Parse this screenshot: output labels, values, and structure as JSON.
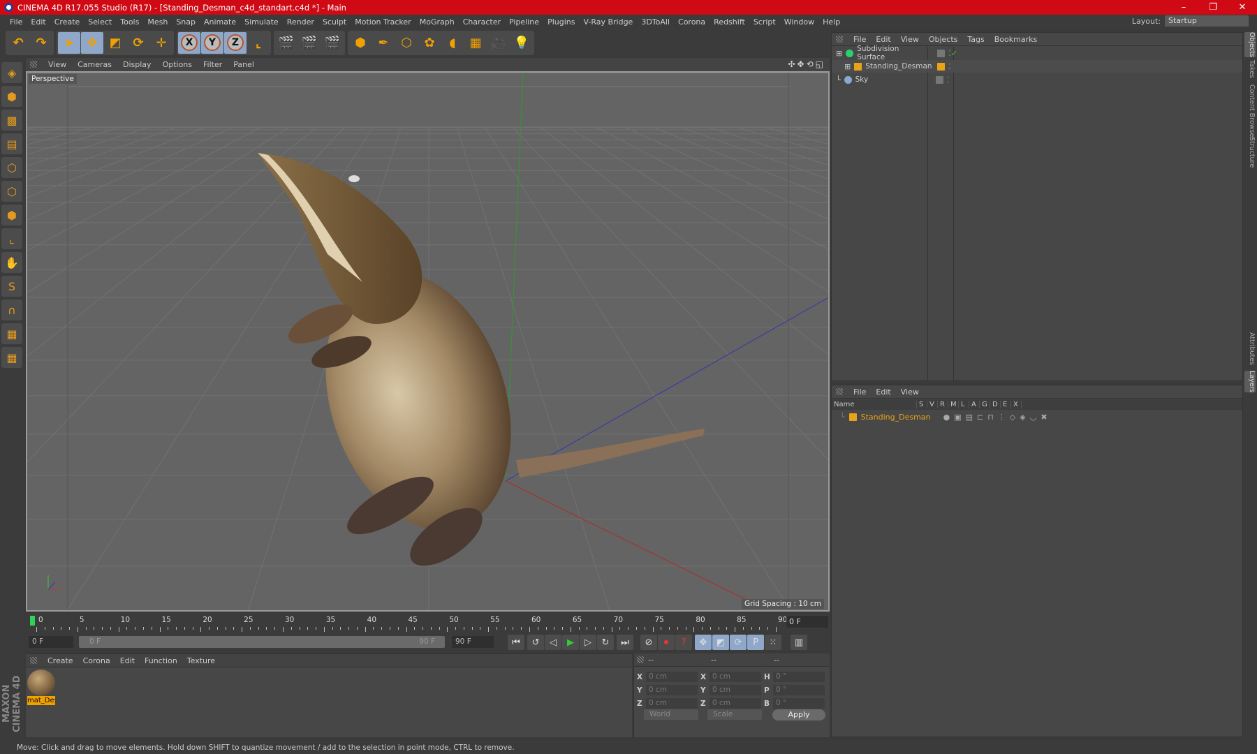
{
  "window": {
    "title": "CINEMA 4D R17.055 Studio (R17) - [Standing_Desman_c4d_standart.c4d *] - Main",
    "controls": [
      "–",
      "❐",
      "✕"
    ]
  },
  "menu": [
    "File",
    "Edit",
    "Create",
    "Select",
    "Tools",
    "Mesh",
    "Snap",
    "Animate",
    "Simulate",
    "Render",
    "Sculpt",
    "Motion Tracker",
    "MoGraph",
    "Character",
    "Pipeline",
    "Plugins",
    "V-Ray Bridge",
    "3DToAll",
    "Corona",
    "Redshift",
    "Script",
    "Window",
    "Help"
  ],
  "layout": {
    "label": "Layout:",
    "value": "Startup"
  },
  "toolbar": [
    {
      "group": [
        {
          "icon": "undo-icon",
          "glyph": "↶"
        },
        {
          "icon": "redo-icon",
          "glyph": "↷"
        }
      ]
    },
    {
      "group": [
        {
          "icon": "select-arrow-icon",
          "glyph": "➤",
          "on": true
        },
        {
          "icon": "move-icon",
          "glyph": "✥",
          "on": true
        },
        {
          "icon": "scale-icon",
          "glyph": "◩"
        },
        {
          "icon": "rotate-icon",
          "glyph": "⟳"
        },
        {
          "icon": "live-move-icon",
          "glyph": "✛"
        }
      ]
    },
    {
      "group": [
        {
          "icon": "x-axis-icon",
          "glyph": "X",
          "axis": true,
          "on": true
        },
        {
          "icon": "y-axis-icon",
          "glyph": "Y",
          "axis": true,
          "on": true
        },
        {
          "icon": "z-axis-icon",
          "glyph": "Z",
          "axis": true,
          "on": true
        },
        {
          "icon": "coordinate-system-icon",
          "glyph": "⌞"
        }
      ]
    },
    {
      "group": [
        {
          "icon": "render-view-icon",
          "glyph": "🎬"
        },
        {
          "icon": "render-picture-viewer-icon",
          "glyph": "🎬"
        },
        {
          "icon": "render-settings-icon",
          "glyph": "🎬"
        }
      ]
    },
    {
      "group": [
        {
          "icon": "cube-icon",
          "glyph": "⬢"
        },
        {
          "icon": "pen-spline-icon",
          "glyph": "✒"
        },
        {
          "icon": "subdivision-icon",
          "glyph": "⬡"
        },
        {
          "icon": "array-icon",
          "glyph": "✿"
        },
        {
          "icon": "deformer-icon",
          "glyph": "◖"
        },
        {
          "icon": "floor-icon",
          "glyph": "▦"
        },
        {
          "icon": "camera-icon",
          "glyph": "🎥"
        },
        {
          "icon": "light-icon",
          "glyph": "💡"
        }
      ]
    }
  ],
  "lefttools": [
    {
      "icon": "make-editable-icon",
      "glyph": "◈"
    },
    {
      "icon": "model-mode-icon",
      "glyph": "⬢"
    },
    {
      "icon": "texture-mode-icon",
      "glyph": "▩"
    },
    {
      "icon": "workplane-icon",
      "glyph": "▤"
    },
    {
      "icon": "points-mode-icon",
      "glyph": "⬡"
    },
    {
      "icon": "edges-mode-icon",
      "glyph": "⬡"
    },
    {
      "icon": "polygons-mode-icon",
      "glyph": "⬢"
    },
    {
      "icon": "axis-mode-icon",
      "glyph": "⌞"
    },
    {
      "icon": "tweak-mode-icon",
      "glyph": "✋"
    },
    {
      "icon": "snap-icon",
      "glyph": "S"
    },
    {
      "icon": "magnet-icon",
      "glyph": "∩"
    },
    {
      "icon": "lock-workplane-icon",
      "glyph": "▦"
    },
    {
      "icon": "planar-workplane-icon",
      "glyph": "▦"
    }
  ],
  "brand": "MAXON CINEMA 4D",
  "viewport": {
    "menu": [
      "View",
      "Cameras",
      "Display",
      "Options",
      "Filter",
      "Panel"
    ],
    "label": "Perspective",
    "grid_spacing": "Grid Spacing : 10 cm",
    "nav_icons": "✣✥⟲◱"
  },
  "timeline": {
    "ticks": [
      0,
      5,
      10,
      15,
      20,
      25,
      30,
      35,
      40,
      45,
      50,
      55,
      60,
      65,
      70,
      75,
      80,
      85,
      90
    ],
    "current_frame": "0 F",
    "start": "0 F",
    "range_start": "0 F",
    "range_end": "90 F",
    "end": "90 F"
  },
  "playback": [
    {
      "icon": "goto-start-icon",
      "glyph": "⏮"
    },
    {
      "icon": "prev-key-icon",
      "glyph": "↺"
    },
    {
      "icon": "prev-frame-icon",
      "glyph": "◁"
    },
    {
      "icon": "play-icon",
      "glyph": "▶"
    },
    {
      "icon": "next-frame-icon",
      "glyph": "▷"
    },
    {
      "icon": "loop-icon",
      "glyph": "↻"
    },
    {
      "icon": "goto-end-icon",
      "glyph": "⏭"
    },
    {
      "icon": "keyframe-icon",
      "glyph": "⊘"
    },
    {
      "icon": "record-icon",
      "glyph": "⏺"
    },
    {
      "icon": "auto-key-icon",
      "glyph": "?"
    },
    {
      "icon": "key-move-icon",
      "glyph": "✥"
    },
    {
      "icon": "key-scale-icon",
      "glyph": "◩"
    },
    {
      "icon": "key-rotate-icon",
      "glyph": "⟳"
    },
    {
      "icon": "key-param-icon",
      "glyph": "P"
    },
    {
      "icon": "key-pla-icon",
      "glyph": "⁙"
    },
    {
      "icon": "timeline-window-icon",
      "glyph": "▥"
    }
  ],
  "materials": {
    "menu": [
      "Create",
      "Corona",
      "Edit",
      "Function",
      "Texture"
    ],
    "items": [
      {
        "name": "mat_Des"
      }
    ]
  },
  "coords": {
    "headers": [
      "--",
      "--",
      "--"
    ],
    "rows": [
      [
        "X",
        "0 cm",
        "X",
        "0 cm",
        "H",
        "0 °"
      ],
      [
        "Y",
        "0 cm",
        "Y",
        "0 cm",
        "P",
        "0 °"
      ],
      [
        "Z",
        "0 cm",
        "Z",
        "0 cm",
        "B",
        "0 °"
      ]
    ],
    "mode": "World",
    "transform": "Scale",
    "apply": "Apply"
  },
  "objects": {
    "menu": [
      "File",
      "Edit",
      "View",
      "Objects",
      "Tags",
      "Bookmarks"
    ],
    "items": [
      {
        "name": "Subdivision Surface",
        "color": "#2bd06a"
      },
      {
        "name": "Standing_Desman",
        "color": "#e8a317"
      },
      {
        "name": "Sky",
        "color": "#8aa8d0"
      }
    ]
  },
  "layers": {
    "menu": [
      "File",
      "Edit",
      "View"
    ],
    "columns": [
      "Name",
      "S",
      "V",
      "R",
      "M",
      "L",
      "A",
      "G",
      "D",
      "E",
      "X"
    ],
    "items": [
      {
        "name": "Standing_Desman",
        "color": "#e8a317"
      }
    ]
  },
  "right_tabs": [
    "Objects",
    "Takes",
    "Content Browser",
    "Structure",
    "Attributes",
    "Layers"
  ],
  "status": "Move: Click and drag to move elements. Hold down SHIFT to quantize movement / add to the selection in point mode, CTRL to remove."
}
